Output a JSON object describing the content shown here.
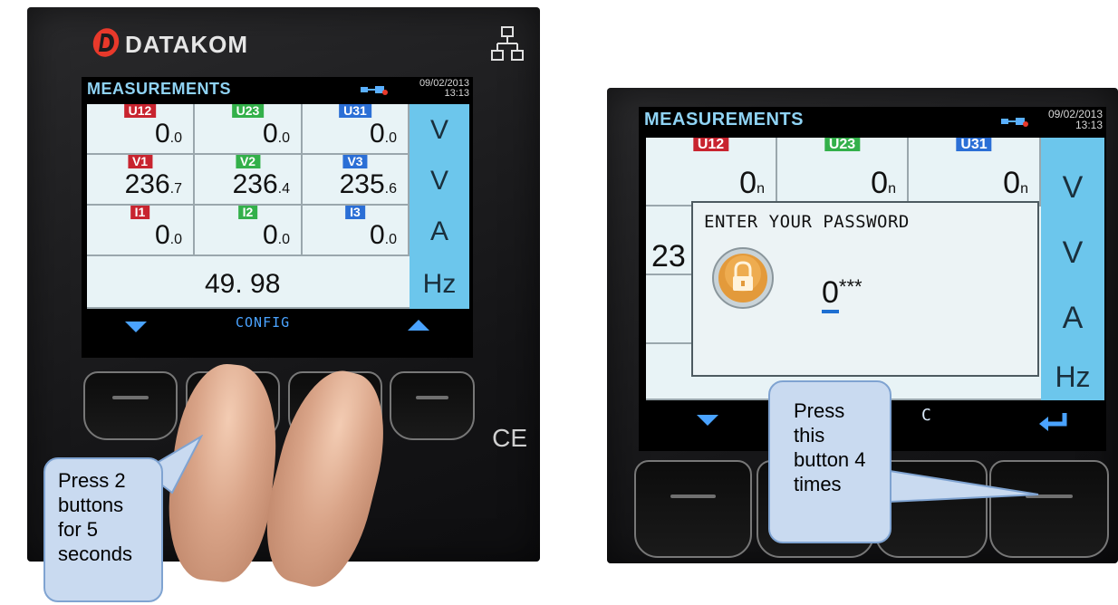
{
  "left_panel": {
    "brand": "DATAKOM",
    "screen": {
      "title": "MEASUREMENTS",
      "date": "09/02/2013",
      "time": "13:13",
      "rows": [
        {
          "tags": [
            "U12",
            "U23",
            "U31"
          ],
          "tag_colors": [
            "red",
            "green",
            "blue"
          ],
          "values": [
            {
              "int": "0",
              "dec": ".0"
            },
            {
              "int": "0",
              "dec": ".0"
            },
            {
              "int": "0",
              "dec": ".0"
            }
          ],
          "unit": "V"
        },
        {
          "tags": [
            "V1",
            "V2",
            "V3"
          ],
          "tag_colors": [
            "red",
            "green",
            "blue"
          ],
          "values": [
            {
              "int": "236",
              "dec": ".7"
            },
            {
              "int": "236",
              "dec": ".4"
            },
            {
              "int": "235",
              "dec": ".6"
            }
          ],
          "unit": "V"
        },
        {
          "tags": [
            "I1",
            "I2",
            "I3"
          ],
          "tag_colors": [
            "red",
            "green",
            "blue"
          ],
          "values": [
            {
              "int": "0",
              "dec": ".0"
            },
            {
              "int": "0",
              "dec": ".0"
            },
            {
              "int": "0",
              "dec": ".0"
            }
          ],
          "unit": "A"
        }
      ],
      "frequency": "49. 98",
      "frequency_unit": "Hz",
      "softkey_center": "CONFIG"
    },
    "callout": "Press 2 buttons for 5 seconds",
    "ce_mark": "CE"
  },
  "right_panel": {
    "screen": {
      "title": "MEASUREMENTS",
      "date": "09/02/2013",
      "time": "13:13",
      "tags": [
        "U12",
        "U23",
        "U31"
      ],
      "values": [
        "0",
        "0",
        "0"
      ],
      "value_decimals": [
        "n",
        "n",
        "n"
      ],
      "partial_value": "23",
      "units": [
        "V",
        "V",
        "A",
        "Hz"
      ],
      "softkey_partial": "C"
    },
    "dialog": {
      "title": "ENTER YOUR PASSWORD",
      "digit": "0",
      "masked": "***"
    },
    "callout": "Press this button 4 times"
  },
  "colors": {
    "screen_bg": "#e8f3f6",
    "unit_column": "#6cc6ec",
    "title_blue": "#8fd3f4",
    "softkey_blue": "#4aa3ff",
    "callout_fill": "#c9daf0",
    "callout_border": "#7fa3d1"
  }
}
